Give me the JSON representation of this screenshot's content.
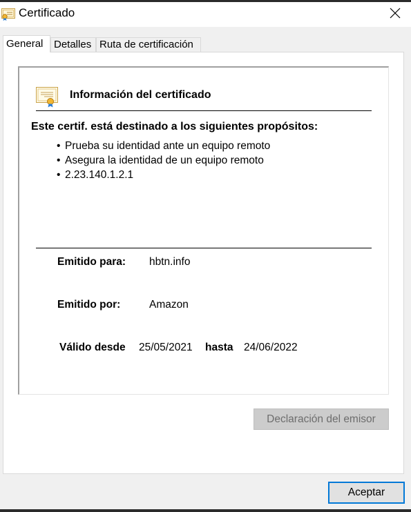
{
  "window": {
    "title": "Certificado",
    "title_icon": "certificate-icon",
    "close_icon": "close-icon"
  },
  "tabs": [
    {
      "label": "General",
      "active": true
    },
    {
      "label": "Detalles",
      "active": false
    },
    {
      "label": "Ruta de certificación",
      "active": false
    }
  ],
  "info": {
    "icon": "certificate-icon",
    "heading": "Información del certificado",
    "purposes_heading": "Este certif. está destinado a los siguientes propósitos:",
    "purposes": [
      "Prueba su identidad ante un equipo remoto",
      "Asegura la identidad de un equipo remoto",
      "2.23.140.1.2.1"
    ],
    "issued_to_label": "Emitido para:",
    "issued_to_value": "hbtn.info",
    "issued_by_label": "Emitido por:",
    "issued_by_value": "Amazon",
    "valid_from_label": "Válido desde",
    "valid_from_value": "25/05/2021",
    "valid_to_label": "hasta",
    "valid_to_value": "24/06/2022"
  },
  "buttons": {
    "issuer_statement": "Declaración del emisor",
    "ok": "Aceptar"
  },
  "colors": {
    "accent": "#0078d7",
    "disabled_button": "#cccccc"
  }
}
